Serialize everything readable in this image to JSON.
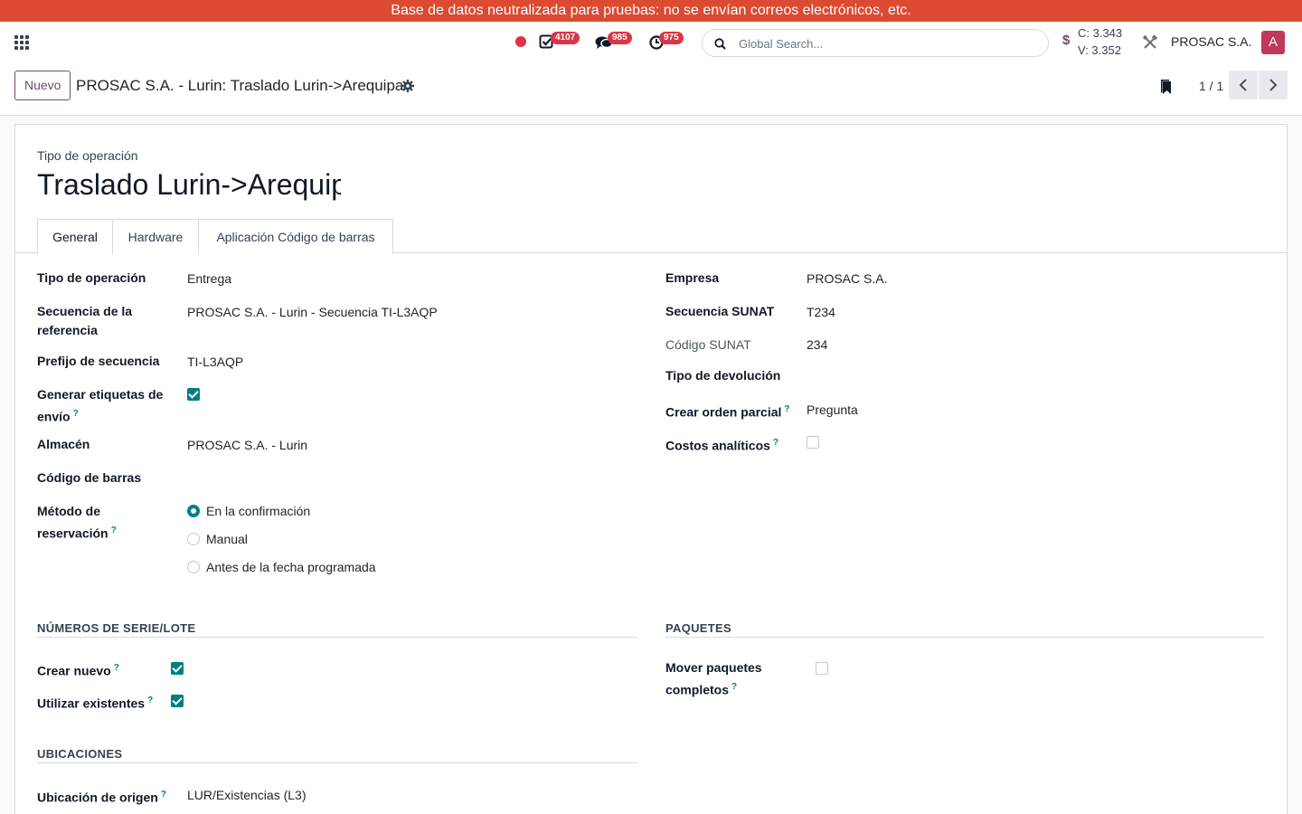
{
  "banner": {
    "text": "Base de datos neutralizada para pruebas: no se envían correos electrónicos, etc."
  },
  "navbar": {
    "apps_icon": "apps-grid-icon",
    "activities_count": "4107",
    "messages_count": "985",
    "timer_count": "975",
    "search_placeholder": "Global Search...",
    "currency_symbol": "$",
    "rate_buy": "C: 3.343",
    "rate_sell": "V: 3.352",
    "company": "PROSAC S.A.",
    "avatar_initial": "A"
  },
  "control_panel": {
    "new_button": "Nuevo",
    "breadcrumb": "PROSAC S.A. - Lurin: Traslado Lurin->Arequipa",
    "pager": "1 / 1"
  },
  "form": {
    "title_label": "Tipo de operación",
    "title_value": "Traslado Lurin->Arequipa",
    "tabs": [
      "General",
      "Hardware",
      "Aplicación Código de barras"
    ],
    "left": {
      "operation_type_label": "Tipo de operación",
      "operation_type_value": "Entrega",
      "sequence_label_1": "Secuencia de la",
      "sequence_label_2": "referencia",
      "sequence_value": "PROSAC S.A. - Lurin - Secuencia TI-L3AQP",
      "prefix_label": "Prefijo de secuencia",
      "prefix_value": "TI-L3AQP",
      "labels_label_1": "Generar etiquetas de",
      "labels_label_2": "envío",
      "labels_checked": true,
      "warehouse_label": "Almacén",
      "warehouse_value": "PROSAC S.A. - Lurin",
      "barcode_label": "Código de barras",
      "reservation_label_1": "Método de",
      "reservation_label_2": "reservación",
      "reservation_options": [
        "En la confirmación",
        "Manual",
        "Antes de la fecha programada"
      ],
      "reservation_selected": "En la confirmación"
    },
    "right": {
      "company_label": "Empresa",
      "company_value": "PROSAC S.A.",
      "sunat_seq_label": "Secuencia SUNAT",
      "sunat_seq_value": "T234",
      "sunat_code_label": "Código SUNAT",
      "sunat_code_value": "234",
      "return_type_label": "Tipo de devolución",
      "partial_label": "Crear orden parcial",
      "partial_value": "Pregunta",
      "analytic_label": "Costos analíticos",
      "analytic_checked": false
    },
    "lots": {
      "title": "NÚMEROS DE SERIE/LOTE",
      "create_label": "Crear nuevo",
      "create_checked": true,
      "use_label": "Utilizar existentes",
      "use_checked": true
    },
    "packages": {
      "title": "PAQUETES",
      "move_label_1": "Mover paquetes",
      "move_label_2": "completos",
      "move_checked": false
    },
    "locations": {
      "title": "UBICACIONES",
      "source_label": "Ubicación de origen",
      "source_value": "LUR/Existencias (L3)"
    },
    "help_mark": "?"
  }
}
